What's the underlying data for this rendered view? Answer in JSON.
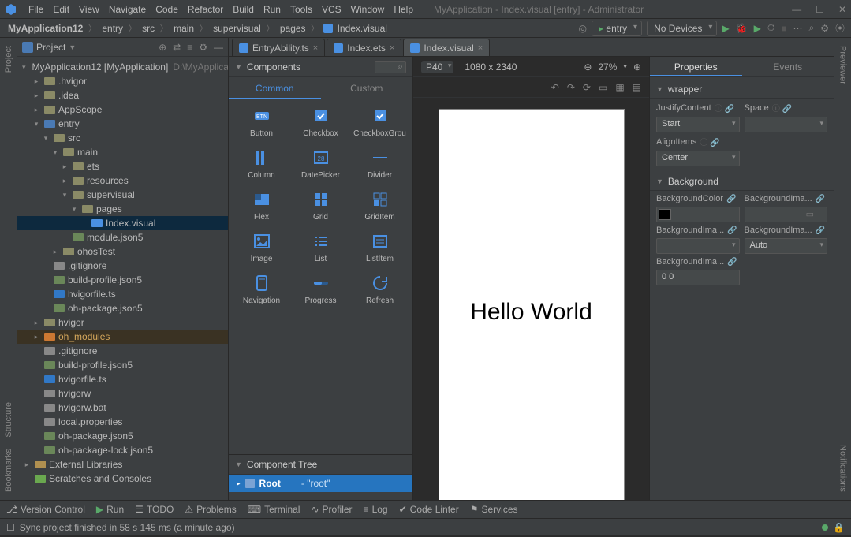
{
  "window": {
    "title": "MyApplication - Index.visual [entry] - Administrator"
  },
  "menu": [
    "File",
    "Edit",
    "View",
    "Navigate",
    "Code",
    "Refactor",
    "Build",
    "Run",
    "Tools",
    "VCS",
    "Window",
    "Help"
  ],
  "breadcrumbs": {
    "app": "MyApplication12",
    "parts": [
      "entry",
      "src",
      "main",
      "supervisual",
      "pages"
    ],
    "file": "Index.visual"
  },
  "toolbar": {
    "entry_label": "entry",
    "devices_label": "No Devices"
  },
  "project_panel": {
    "title": "Project"
  },
  "tree": [
    {
      "d": 0,
      "exp": "▾",
      "icon": "proj",
      "label": "MyApplication12 [MyApplication]",
      "meta": "D:\\MyApplicatio"
    },
    {
      "d": 1,
      "exp": "▸",
      "icon": "dir",
      "label": ".hvigor"
    },
    {
      "d": 1,
      "exp": "▸",
      "icon": "dir",
      "label": ".idea"
    },
    {
      "d": 1,
      "exp": "▸",
      "icon": "dir",
      "label": "AppScope"
    },
    {
      "d": 1,
      "exp": "▾",
      "icon": "mod",
      "label": "entry"
    },
    {
      "d": 2,
      "exp": "▾",
      "icon": "dir",
      "label": "src"
    },
    {
      "d": 3,
      "exp": "▾",
      "icon": "dir",
      "label": "main"
    },
    {
      "d": 4,
      "exp": "▸",
      "icon": "dir",
      "label": "ets"
    },
    {
      "d": 4,
      "exp": "▸",
      "icon": "dir",
      "label": "resources"
    },
    {
      "d": 4,
      "exp": "▾",
      "icon": "dir",
      "label": "supervisual"
    },
    {
      "d": 5,
      "exp": "▾",
      "icon": "dir",
      "label": "pages"
    },
    {
      "d": 6,
      "exp": "",
      "icon": "vis",
      "label": "Index.visual",
      "sel": true
    },
    {
      "d": 4,
      "exp": "",
      "icon": "json",
      "label": "module.json5"
    },
    {
      "d": 3,
      "exp": "▸",
      "icon": "dir",
      "label": "ohosTest"
    },
    {
      "d": 2,
      "exp": "",
      "icon": "file",
      "label": ".gitignore"
    },
    {
      "d": 2,
      "exp": "",
      "icon": "json",
      "label": "build-profile.json5"
    },
    {
      "d": 2,
      "exp": "",
      "icon": "ts",
      "label": "hvigorfile.ts"
    },
    {
      "d": 2,
      "exp": "",
      "icon": "json",
      "label": "oh-package.json5"
    },
    {
      "d": 1,
      "exp": "▸",
      "icon": "dir",
      "label": "hvigor"
    },
    {
      "d": 1,
      "exp": "▸",
      "icon": "dirhl",
      "label": "oh_modules",
      "hl": true
    },
    {
      "d": 1,
      "exp": "",
      "icon": "file",
      "label": ".gitignore"
    },
    {
      "d": 1,
      "exp": "",
      "icon": "json",
      "label": "build-profile.json5"
    },
    {
      "d": 1,
      "exp": "",
      "icon": "ts",
      "label": "hvigorfile.ts"
    },
    {
      "d": 1,
      "exp": "",
      "icon": "file",
      "label": "hvigorw"
    },
    {
      "d": 1,
      "exp": "",
      "icon": "file",
      "label": "hvigorw.bat"
    },
    {
      "d": 1,
      "exp": "",
      "icon": "file",
      "label": "local.properties"
    },
    {
      "d": 1,
      "exp": "",
      "icon": "json",
      "label": "oh-package.json5"
    },
    {
      "d": 1,
      "exp": "",
      "icon": "json",
      "label": "oh-package-lock.json5"
    },
    {
      "d": 0,
      "exp": "▸",
      "icon": "lib",
      "label": "External Libraries"
    },
    {
      "d": 0,
      "exp": "",
      "icon": "scr",
      "label": "Scratches and Consoles"
    }
  ],
  "editor_tabs": [
    {
      "label": "EntryAbility.ts",
      "active": false
    },
    {
      "label": "Index.ets",
      "active": false
    },
    {
      "label": "Index.visual",
      "active": true
    }
  ],
  "components": {
    "title": "Components",
    "tabs": {
      "common": "Common",
      "custom": "Custom"
    },
    "items": [
      [
        "Button",
        "Checkbox",
        "CheckboxGrou"
      ],
      [
        "Column",
        "DatePicker",
        "Divider"
      ],
      [
        "Flex",
        "Grid",
        "GridItem"
      ],
      [
        "Image",
        "List",
        "ListItem"
      ],
      [
        "Navigation",
        "Progress",
        "Refresh"
      ]
    ],
    "tree_title": "Component Tree",
    "root_label": "Root",
    "root_meta": "- \"root\""
  },
  "canvas": {
    "device": "P40",
    "resolution": "1080 x 2340",
    "zoom": "27%",
    "hello": "Hello World"
  },
  "properties": {
    "tab_props": "Properties",
    "tab_events": "Events",
    "sect_wrapper": "wrapper",
    "justify_lbl": "JustifyContent",
    "justify_val": "Start",
    "space_lbl": "Space",
    "space_val": "",
    "align_lbl": "AlignItems",
    "align_val": "Center",
    "sect_bg": "Background",
    "bgcolor_lbl": "BackgroundColor",
    "bgimg_lbl": "BackgroundIma...",
    "bgimg2_lbl": "BackgroundIma...",
    "bgimg2_val": "",
    "bgimg3_lbl": "BackgroundIma...",
    "bgimg3_val": "Auto",
    "bgimg4_lbl": "BackgroundIma...",
    "bgimg4_val": "0 0"
  },
  "leftrail": {
    "project": "Project",
    "structure": "Structure",
    "bookmarks": "Bookmarks"
  },
  "rightrail": {
    "previewer": "Previewer",
    "notifications": "Notifications"
  },
  "bottombar": {
    "vc": "Version Control",
    "run": "Run",
    "todo": "TODO",
    "problems": "Problems",
    "terminal": "Terminal",
    "profiler": "Profiler",
    "log": "Log",
    "lint": "Code Linter",
    "services": "Services"
  },
  "status": {
    "msg": "Sync project finished in 58 s 145 ms (a minute ago)"
  }
}
